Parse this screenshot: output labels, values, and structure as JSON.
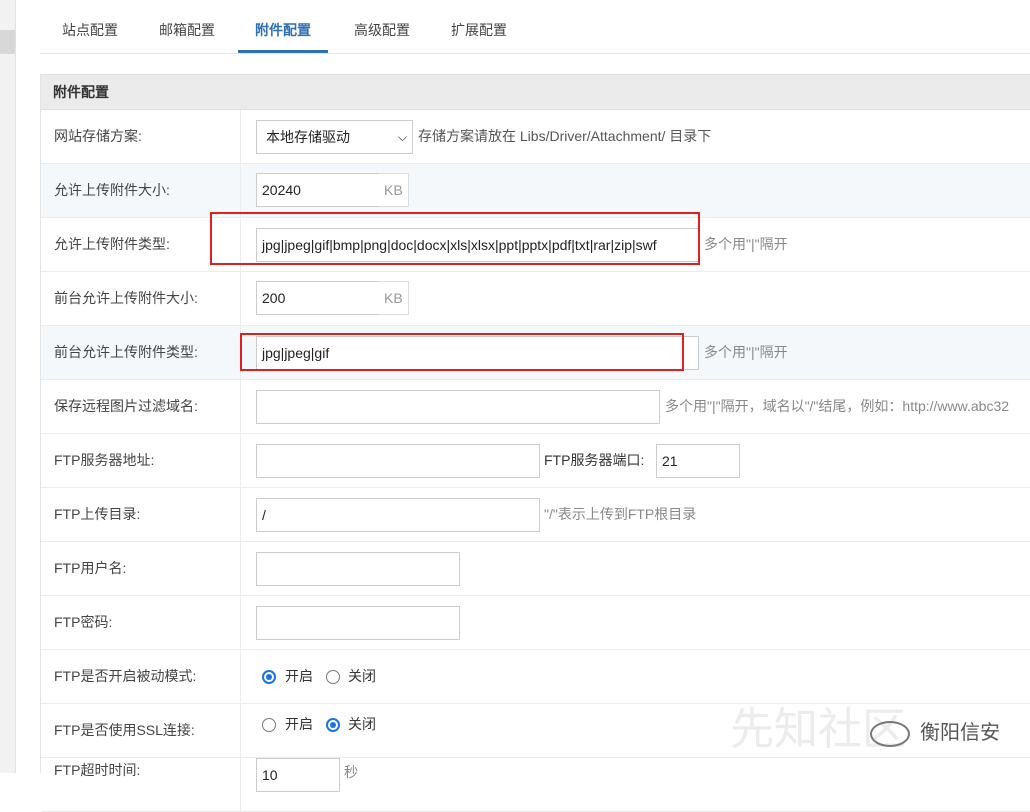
{
  "tabs": [
    "站点配置",
    "邮箱配置",
    "附件配置",
    "高级配置",
    "扩展配置"
  ],
  "active_tab": "附件配置",
  "panel_title": "附件配置",
  "storage": {
    "label": "网站存储方案:",
    "selected": "本地存储驱动",
    "hint": "存储方案请放在 Libs/Driver/Attachment/ 目录下"
  },
  "upload_size": {
    "label": "允许上传附件大小:",
    "value": "20240",
    "unit": "KB"
  },
  "upload_types": {
    "label": "允许上传附件类型:",
    "value": "jpg|jpeg|gif|bmp|png|doc|docx|xls|xlsx|ppt|pptx|pdf|txt|rar|zip|swf",
    "hint": "多个用\"|\"隔开"
  },
  "front_size": {
    "label": "前台允许上传附件大小:",
    "value": "200",
    "unit": "KB"
  },
  "front_types": {
    "label": "前台允许上传附件类型:",
    "value": "jpg|jpeg|gif",
    "hint": "多个用\"|\"隔开"
  },
  "remote_filter": {
    "label": "保存远程图片过滤域名:",
    "value": "",
    "hint": "多个用\"|\"隔开，域名以\"/\"结尾，例如：http://www.abc32"
  },
  "ftp_host": {
    "label": "FTP服务器地址:",
    "value": "",
    "port_label": "FTP服务器端口:",
    "port": "21"
  },
  "ftp_dir": {
    "label": "FTP上传目录:",
    "value": "/",
    "hint": "\"/\"表示上传到FTP根目录"
  },
  "ftp_user": {
    "label": "FTP用户名:",
    "value": ""
  },
  "ftp_pass": {
    "label": "FTP密码:",
    "value": ""
  },
  "ftp_passive": {
    "label": "FTP是否开启被动模式:",
    "on": "开启",
    "off": "关闭",
    "selected": "on"
  },
  "ftp_ssl": {
    "label": "FTP是否使用SSL连接:",
    "on": "开启",
    "off": "关闭",
    "selected": "off"
  },
  "ftp_timeout": {
    "label": "FTP超时时间:",
    "value": "10",
    "unit": "秒"
  },
  "watermark": {
    "text": "衡阳信安",
    "ghost": "先知社区"
  }
}
